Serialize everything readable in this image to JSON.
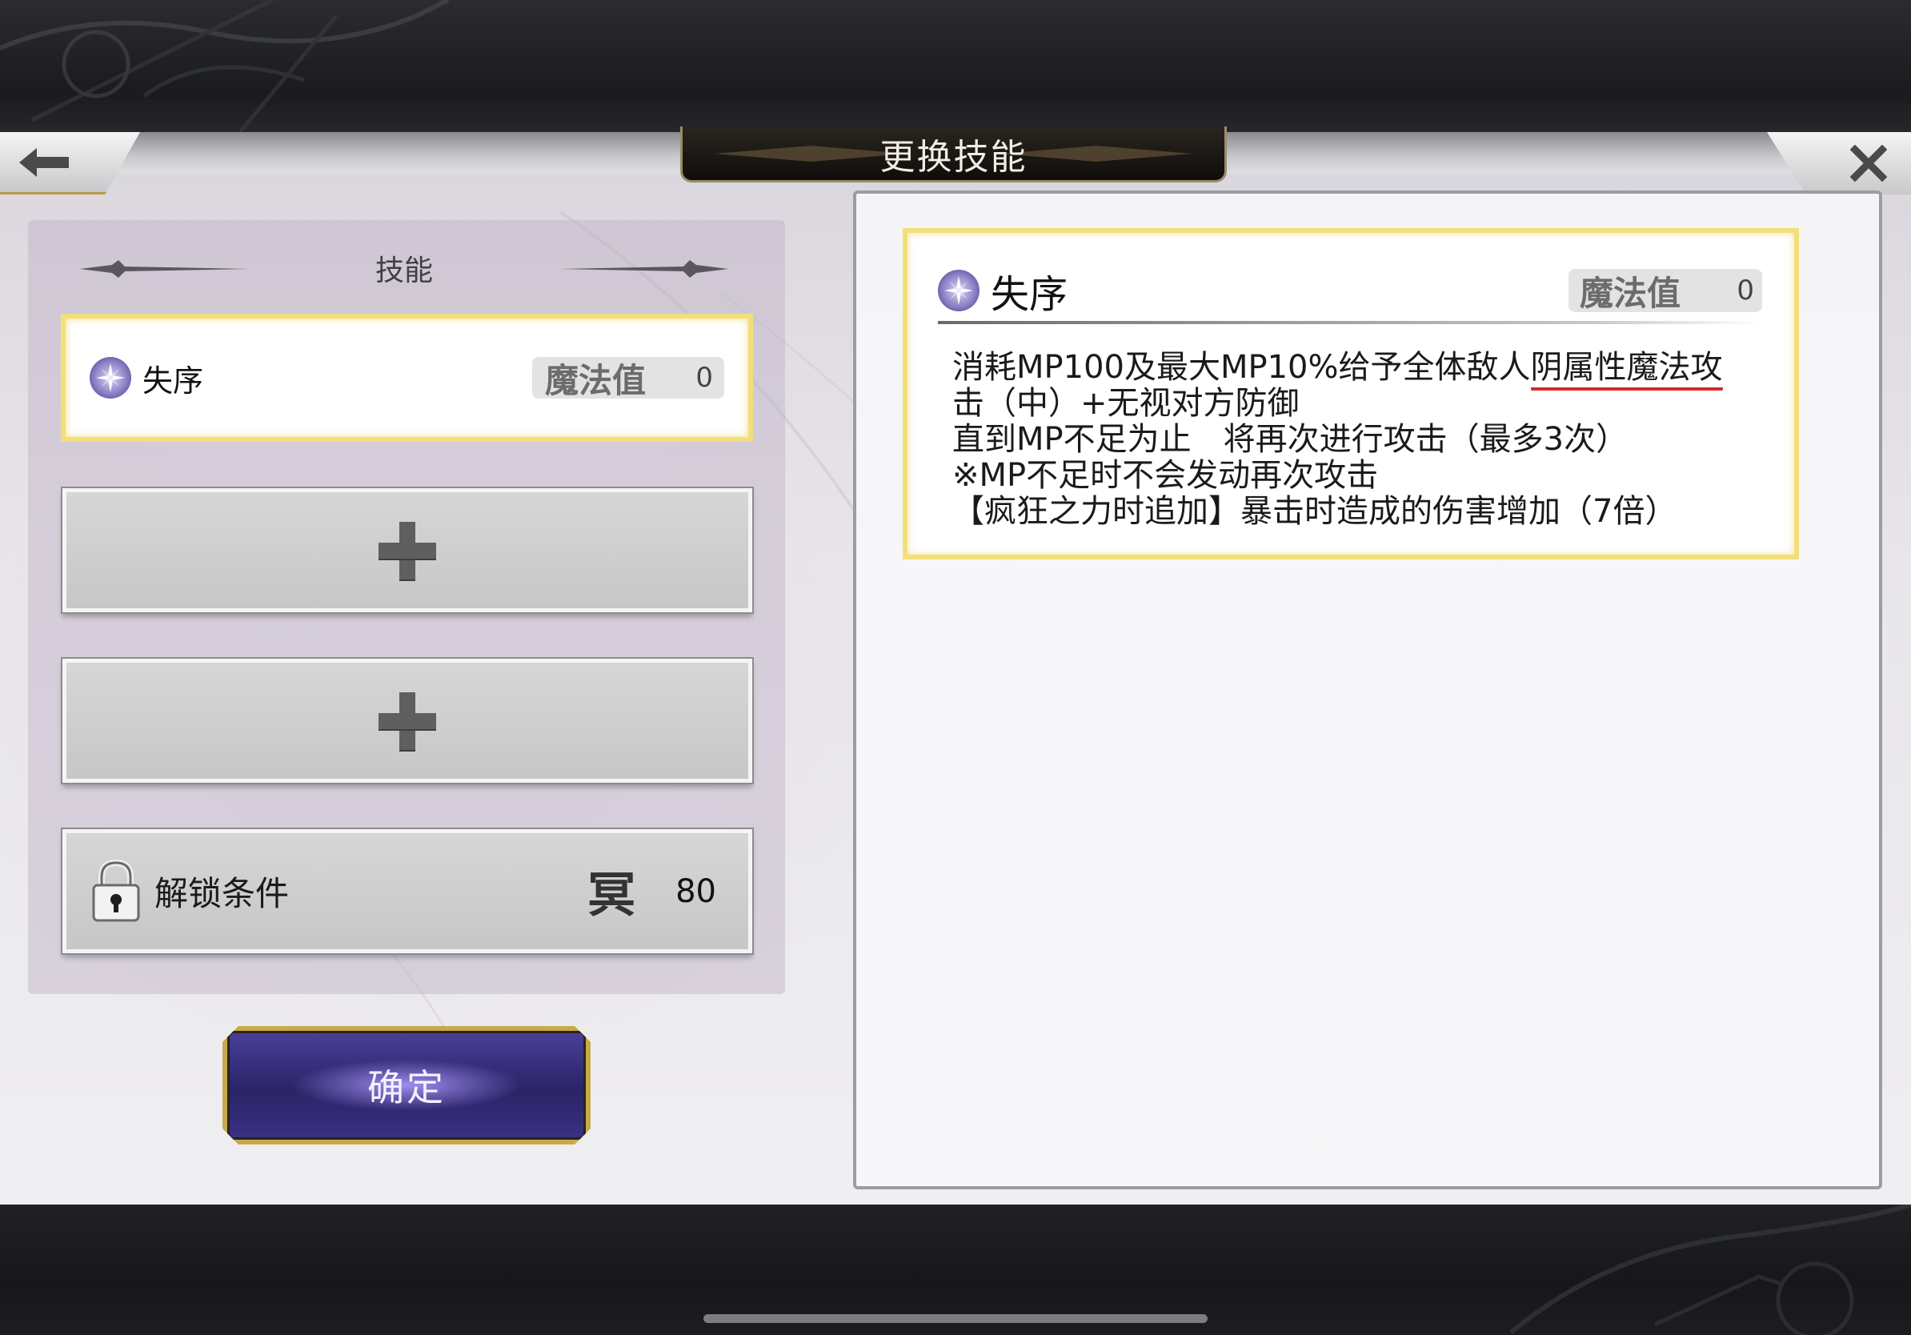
{
  "header": {
    "title": "更换技能",
    "back_icon": "arrow-left-icon",
    "close_icon": "close-icon"
  },
  "left": {
    "section_title": "技能",
    "selected_skill": {
      "icon": "compass-star-icon",
      "name": "失序",
      "mp_label": "魔法值",
      "mp_value": "0"
    },
    "empty_slots": [
      {
        "icon": "plus-icon"
      },
      {
        "icon": "plus-icon"
      }
    ],
    "locked_slot": {
      "icon": "lock-icon",
      "label": "解锁条件",
      "rank_glyph": "冥",
      "value": "80"
    },
    "confirm_label": "确定"
  },
  "detail": {
    "icon": "compass-star-icon",
    "name": "失序",
    "mp_label": "魔法值",
    "mp_value": "0",
    "line1_prefix": "消耗MP100及最大MP10%给予全体敌人",
    "line1_underlined": "阴属性魔法攻",
    "line2": "击（中）+无视对方防御",
    "line3": "直到MP不足为止　将再次进行攻击（最多3次）",
    "line4": "※MP不足时不会发动再次攻击",
    "line5": "【疯狂之力时追加】暴击时造成的伤害增加（7倍）"
  },
  "colors": {
    "card_border": "#f2df79",
    "confirm_bg": "#2a2466",
    "confirm_border": "#c7a94d",
    "underline": "#d42a2a"
  }
}
